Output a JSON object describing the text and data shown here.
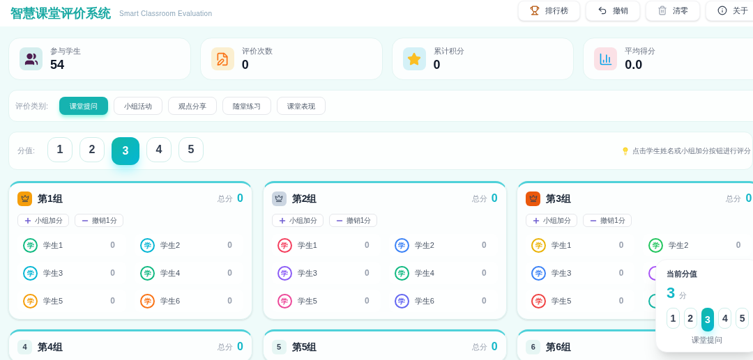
{
  "header": {
    "title": "智慧课堂评价系统",
    "subtitle": "Smart Classroom Evaluation",
    "actions": [
      {
        "kind": "trophy",
        "label": "排行榜"
      },
      {
        "kind": "undo",
        "label": "撤销"
      },
      {
        "kind": "clear",
        "label": "清零"
      },
      {
        "kind": "info",
        "label": "关于"
      }
    ]
  },
  "stats": [
    {
      "kind": "students",
      "label": "参与学生",
      "value": "54"
    },
    {
      "kind": "count",
      "label": "评价次数",
      "value": "0"
    },
    {
      "kind": "points",
      "label": "累计积分",
      "value": "0"
    },
    {
      "kind": "average",
      "label": "平均得分",
      "value": "0.0"
    }
  ],
  "categories": {
    "label": "评价类别:",
    "items": [
      {
        "label": "课堂提问",
        "selected": true
      },
      {
        "label": "小组活动",
        "selected": false
      },
      {
        "label": "观点分享",
        "selected": false
      },
      {
        "label": "随堂练习",
        "selected": false
      },
      {
        "label": "课堂表现",
        "selected": false
      }
    ]
  },
  "score_values": {
    "label": "分值:",
    "items": [
      {
        "label": "1",
        "selected": false
      },
      {
        "label": "2",
        "selected": false
      },
      {
        "label": "3",
        "selected": true
      },
      {
        "label": "4",
        "selected": false
      },
      {
        "label": "5",
        "selected": false
      }
    ],
    "hint": "点击学生姓名或小组加分按钮进行评分"
  },
  "groups": [
    {
      "kind": "icon",
      "color": "#f59e0b",
      "name": "第1组",
      "total_label": "总分",
      "total": "0",
      "add": "小组加分",
      "undo": "撤销1分",
      "students": [
        {
          "avatar": "学",
          "name": "学生1",
          "score": "0",
          "color": "#10b981"
        },
        {
          "avatar": "学",
          "name": "学生2",
          "score": "0",
          "color": "#06b6d4"
        },
        {
          "avatar": "学",
          "name": "学生3",
          "score": "0",
          "color": "#06b6d4"
        },
        {
          "avatar": "学",
          "name": "学生4",
          "score": "0",
          "color": "#10b981"
        },
        {
          "avatar": "学",
          "name": "学生5",
          "score": "0",
          "color": "#f59e0b"
        },
        {
          "avatar": "学",
          "name": "学生6",
          "score": "0",
          "color": "#f97316"
        }
      ]
    },
    {
      "kind": "icon",
      "color": "#cbd5e1",
      "name": "第2组",
      "total_label": "总分",
      "total": "0",
      "add": "小组加分",
      "undo": "撤销1分",
      "students": [
        {
          "avatar": "学",
          "name": "学生1",
          "score": "0",
          "color": "#f43f5e"
        },
        {
          "avatar": "学",
          "name": "学生2",
          "score": "0",
          "color": "#3b82f6"
        },
        {
          "avatar": "学",
          "name": "学生3",
          "score": "0",
          "color": "#8b5cf6"
        },
        {
          "avatar": "学",
          "name": "学生4",
          "score": "0",
          "color": "#10b981"
        },
        {
          "avatar": "学",
          "name": "学生5",
          "score": "0",
          "color": "#ec4899"
        },
        {
          "avatar": "学",
          "name": "学生6",
          "score": "0",
          "color": "#6366f1"
        }
      ]
    },
    {
      "kind": "icon",
      "color": "#ea580c",
      "name": "第3组",
      "total_label": "总分",
      "total": "0",
      "add": "小组加分",
      "undo": "撤销1分",
      "students": [
        {
          "avatar": "学",
          "name": "学生1",
          "score": "0",
          "color": "#eab308"
        },
        {
          "avatar": "学",
          "name": "学生2",
          "score": "0",
          "color": "#22c55e"
        },
        {
          "avatar": "学",
          "name": "学生3",
          "score": "0",
          "color": "#3b82f6"
        },
        {
          "color": "#a855f7"
        },
        {
          "avatar": "学",
          "name": "学生5",
          "score": "0",
          "color": "#ef4444"
        },
        {
          "color": "#14b8a6"
        }
      ]
    },
    {
      "kind": "number",
      "number": "4",
      "name": "第4组",
      "total_label": "总分",
      "total": "0"
    },
    {
      "kind": "number",
      "number": "5",
      "name": "第5组",
      "total_label": "总分",
      "total": "0"
    },
    {
      "kind": "number",
      "number": "6",
      "name": "第6组"
    }
  ],
  "current_value": {
    "title": "当前分值",
    "value": "3",
    "unit": "分",
    "items": [
      {
        "label": "1",
        "selected": false
      },
      {
        "label": "2",
        "selected": false
      },
      {
        "label": "3",
        "selected": true
      },
      {
        "label": "4",
        "selected": false
      },
      {
        "label": "5",
        "selected": false
      }
    ],
    "category": "课堂提问"
  }
}
